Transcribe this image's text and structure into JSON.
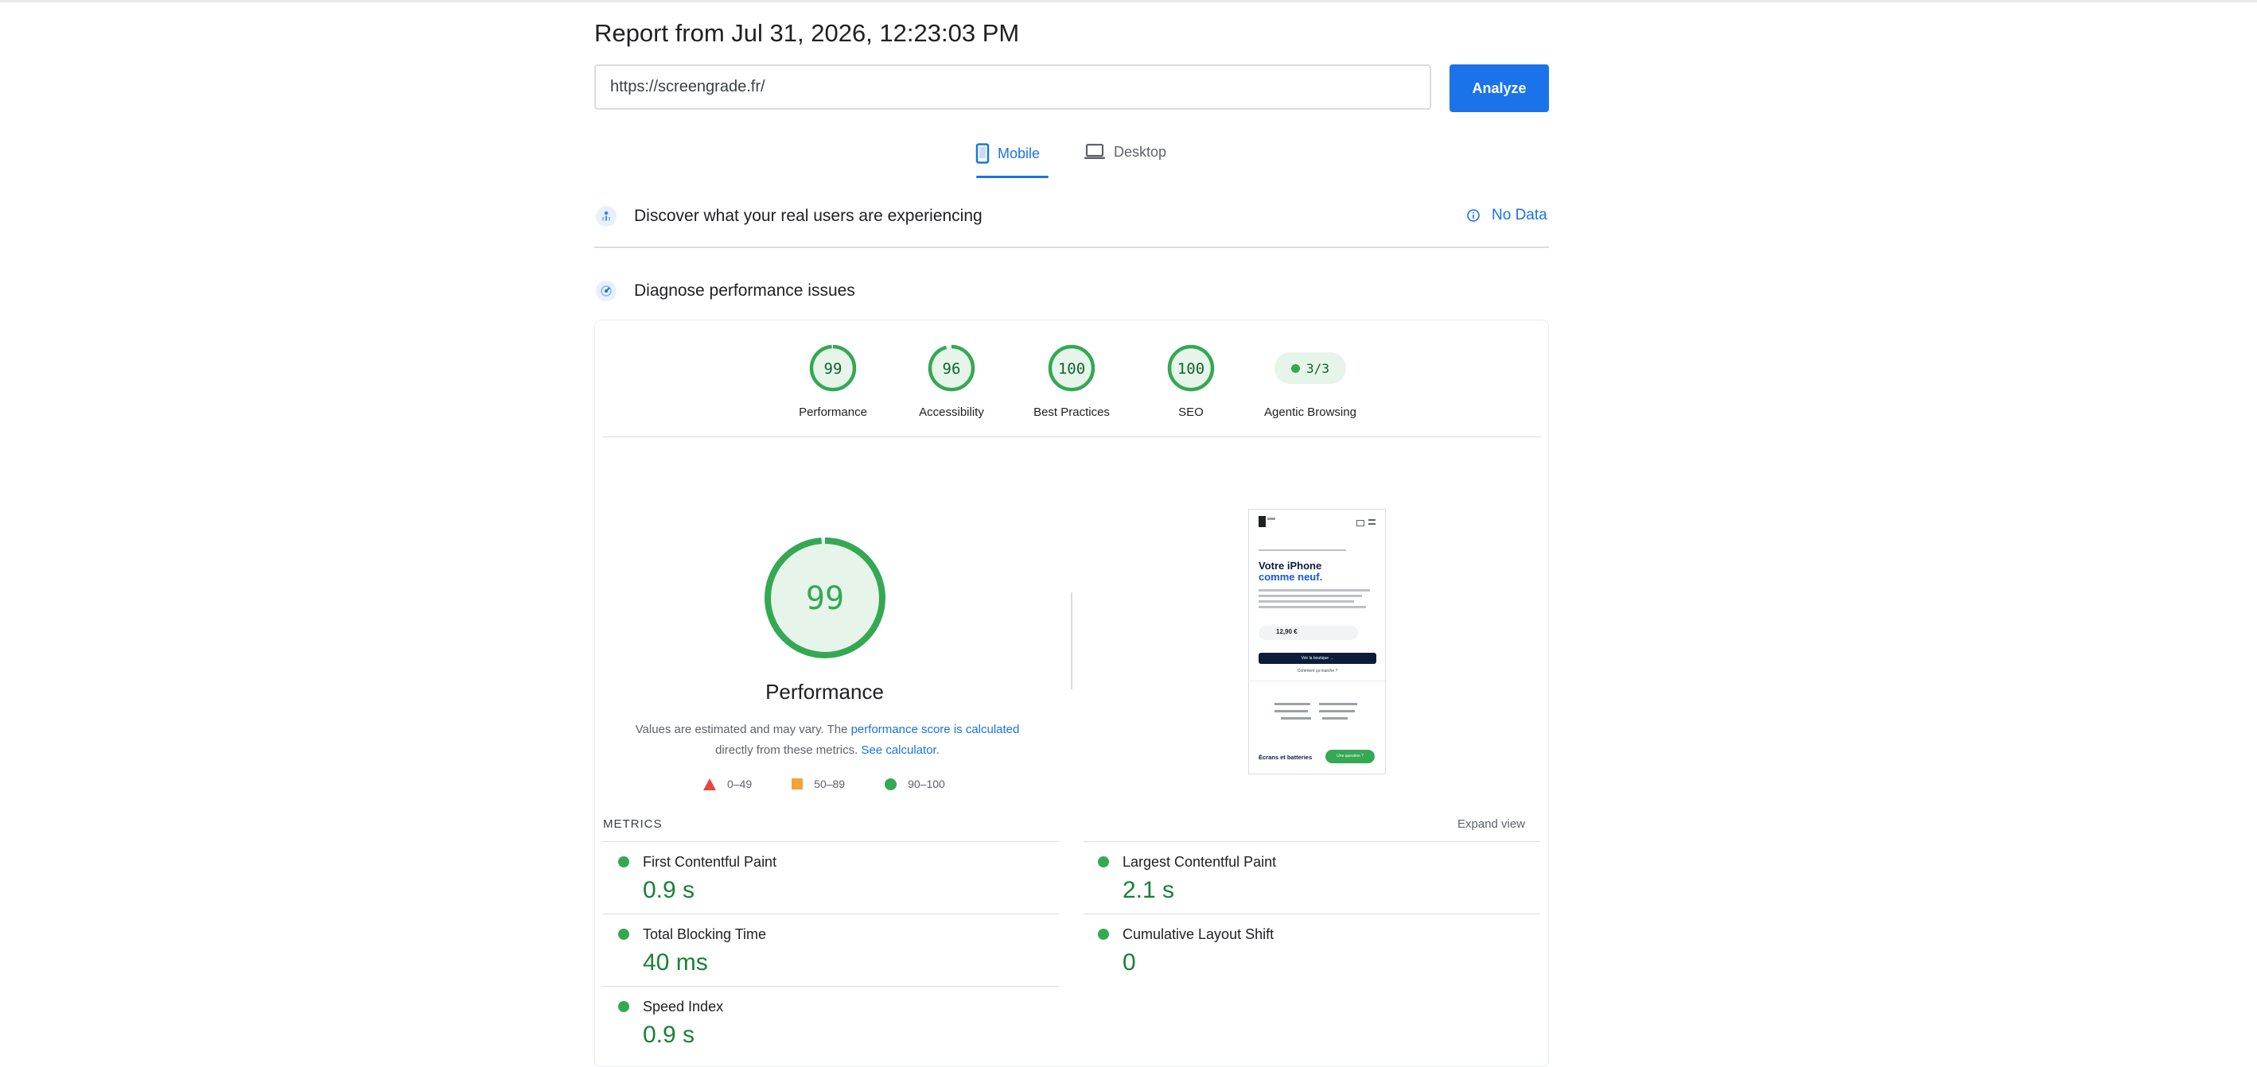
{
  "report": {
    "title": "Report from Jul 31, 2026, 12:23:03 PM",
    "url_value": "https://screengrade.fr/",
    "analyze_label": "Analyze"
  },
  "tabs": [
    {
      "label": "Mobile",
      "icon": "phone-icon",
      "active": true
    },
    {
      "label": "Desktop",
      "icon": "laptop-icon",
      "active": false
    }
  ],
  "field_data": {
    "title": "Discover what your real users are experiencing",
    "status": "No Data"
  },
  "diagnose": {
    "title": "Diagnose performance issues"
  },
  "categories": [
    {
      "label": "Performance",
      "score": "99",
      "fraction": 0.99
    },
    {
      "label": "Accessibility",
      "score": "96",
      "fraction": 0.96
    },
    {
      "label": "Best Practices",
      "score": "100",
      "fraction": 1.0
    },
    {
      "label": "SEO",
      "score": "100",
      "fraction": 1.0
    },
    {
      "label": "Agentic Browsing",
      "score": "3/3"
    }
  ],
  "performance": {
    "score": "99",
    "fraction": 0.99,
    "label": "Performance",
    "note_prefix": "Values are estimated and may vary. The ",
    "note_link1": "performance score is calculated",
    "note_middle": " directly from these metrics. ",
    "note_link2": "See calculator",
    "note_suffix": ".",
    "legend": [
      "0–49",
      "50–89",
      "90–100"
    ]
  },
  "colors": {
    "pass": "#34a853",
    "average": "#f4a23a",
    "fail": "#e8453c",
    "accent": "#1a73e8"
  },
  "screenshot": {
    "heading1": "Votre iPhone",
    "heading2": "comme neuf.",
    "price": "12,90 €",
    "cta": "Voir la boutique →",
    "link": "Comment ça marche ?",
    "bottom_title": "Écrans et batteries",
    "chat_label": "Une question ?"
  },
  "metrics": {
    "heading": "METRICS",
    "expand": "Expand view",
    "items": [
      {
        "name": "First Contentful Paint",
        "value": "0.9 s"
      },
      {
        "name": "Largest Contentful Paint",
        "value": "2.1 s"
      },
      {
        "name": "Total Blocking Time",
        "value": "40 ms"
      },
      {
        "name": "Cumulative Layout Shift",
        "value": "0"
      },
      {
        "name": "Speed Index",
        "value": "0.9 s"
      }
    ]
  }
}
